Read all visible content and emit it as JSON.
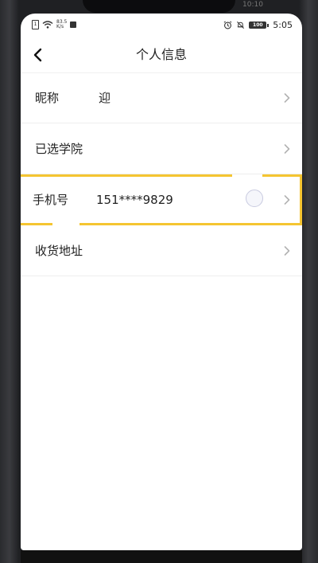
{
  "status_bar": {
    "sim_label": "1",
    "network_speed_value": "83.5",
    "network_speed_unit": "K/s",
    "battery_level": "100",
    "time": "5:05",
    "top_time": "10:10"
  },
  "header": {
    "title": "个人信息",
    "back_icon": "chevron-left-icon"
  },
  "rows": [
    {
      "label": "昵称",
      "value": "迎"
    },
    {
      "label": "已选学院",
      "value": ""
    },
    {
      "label": "手机号",
      "value": "151****9829"
    },
    {
      "label": "收货地址",
      "value": ""
    }
  ],
  "colors": {
    "highlight_border": "#f5c531",
    "text": "#222222",
    "divider": "#eeeeee",
    "chevron": "#b3b3b3"
  }
}
